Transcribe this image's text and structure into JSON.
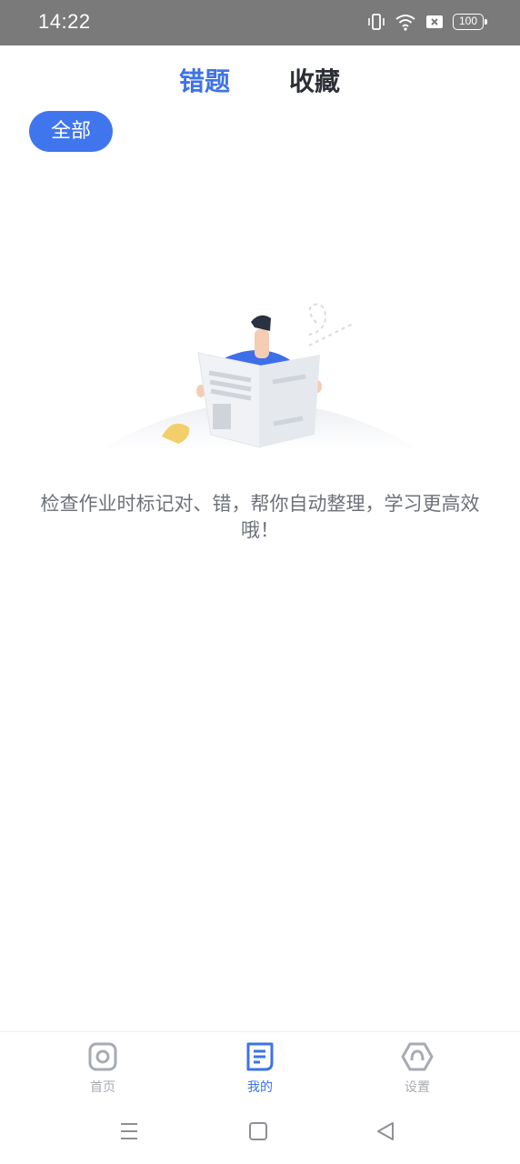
{
  "status_bar": {
    "time": "14:22",
    "battery": "100",
    "icons": [
      "vibrate-icon",
      "wifi-icon",
      "sim-off-icon",
      "battery-icon"
    ]
  },
  "tabs": [
    {
      "label": "错题",
      "active": true
    },
    {
      "label": "收藏",
      "active": false
    }
  ],
  "filter": {
    "label": "全部"
  },
  "empty_state": {
    "message": "检查作业时标记对、错，帮你自动整理，学习更高效哦！",
    "illustration": "person-reading-newspaper"
  },
  "bottom_nav": [
    {
      "label": "首页",
      "icon": "home-icon",
      "active": false
    },
    {
      "label": "我的",
      "icon": "document-icon",
      "active": true
    },
    {
      "label": "设置",
      "icon": "settings-icon",
      "active": false
    }
  ],
  "system_nav": [
    "menu-icon",
    "home-square-icon",
    "back-triangle-icon"
  ],
  "colors": {
    "accent": "#3e73e6",
    "chip": "#3f76ee",
    "text_muted": "#6d7179",
    "nav_inactive": "#a7abb2",
    "status_bar": "#7a7a7a"
  }
}
